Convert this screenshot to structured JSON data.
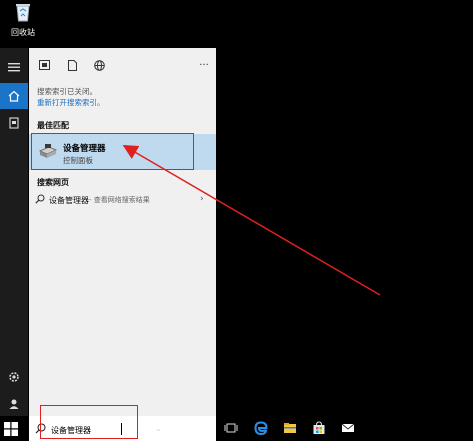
{
  "desktop": {
    "recycle_bin_label": "回收站"
  },
  "rail": {
    "items": [
      "hamburger-menu",
      "home",
      "documents",
      "settings",
      "user"
    ]
  },
  "toolbar": {
    "icons": [
      "apps-icon",
      "document-icon",
      "web-icon"
    ],
    "more_label": "···"
  },
  "search_notice": {
    "text": "搜索索引已关闭。",
    "link": "重新打开搜索索引。"
  },
  "sections": {
    "best_match": "最佳匹配",
    "search_web": "搜索网页"
  },
  "best_match": {
    "title": "设备管理器",
    "subtitle": "控制面板"
  },
  "web_result": {
    "query": "设备管理器",
    "hint": "- 查看网络搜索结果",
    "chevron": "›"
  },
  "searchbar": {
    "value": "设备管理器"
  },
  "taskbar": {
    "icons": [
      "task-view-icon",
      "edge-icon",
      "file-explorer-icon",
      "store-icon",
      "mail-icon"
    ]
  },
  "colors": {
    "accent": "#1a74c8",
    "highlight": "#bfd9ef",
    "annotation": "#e0201c"
  }
}
